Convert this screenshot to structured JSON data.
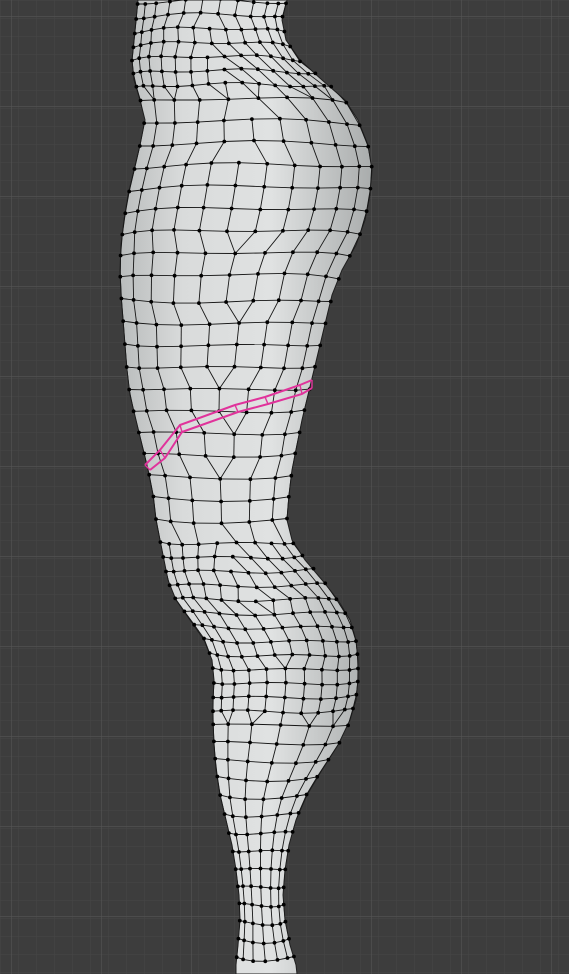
{
  "viewport": {
    "view": "side-orthographic",
    "mode": "edit-mode",
    "select_mode": "edge",
    "background_color": "#3d3d3d",
    "grid_minor_color": "#474747",
    "grid_major_color": "#525252"
  },
  "mesh": {
    "object": "leg-mesh",
    "surface_color": "#d6d8d8",
    "edge_color": "#151515",
    "vertex_color": "#000000",
    "selected_edge_color": "#e0339b"
  },
  "selection": {
    "type": "edge-loop",
    "count": 1
  }
}
